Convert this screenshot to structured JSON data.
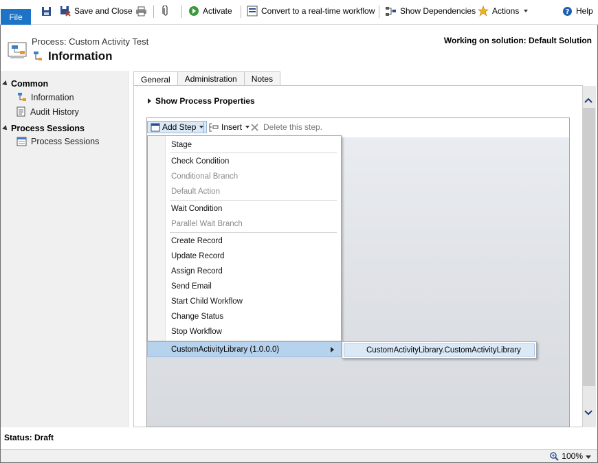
{
  "ribbon": {
    "file_label": "File",
    "save_close": "Save and Close",
    "activate": "Activate",
    "convert": "Convert to a real-time workflow",
    "show_dependencies": "Show Dependencies",
    "actions": "Actions",
    "help": "Help"
  },
  "header": {
    "subtitle": "Process: Custom Activity Test",
    "title": "Information",
    "solution": "Working on solution: Default Solution"
  },
  "nav": {
    "common": "Common",
    "information": "Information",
    "audit_history": "Audit History",
    "process_sessions_header": "Process Sessions",
    "process_sessions": "Process Sessions"
  },
  "tabs": [
    "General",
    "Administration",
    "Notes"
  ],
  "show_props": "Show Process Properties",
  "designer_toolbar": {
    "add_step": "Add Step",
    "insert": "Insert",
    "delete": "Delete this step."
  },
  "menu": {
    "stage": "Stage",
    "check_condition": "Check Condition",
    "conditional_branch": "Conditional Branch",
    "default_action": "Default Action",
    "wait_condition": "Wait Condition",
    "parallel_wait_branch": "Parallel Wait Branch",
    "create_record": "Create Record",
    "update_record": "Update Record",
    "assign_record": "Assign Record",
    "send_email": "Send Email",
    "start_child_workflow": "Start Child Workflow",
    "change_status": "Change Status",
    "stop_workflow": "Stop Workflow",
    "custom_library": "CustomActivityLibrary (1.0.0.0)"
  },
  "flyout_item": "CustomActivityLibrary.CustomActivityLibrary",
  "status": "Status: Draft",
  "zoom": "100%",
  "colors": {
    "file_button": "#1d73c5",
    "menu_highlight": "#b7d2ec",
    "canvas": "#dde0e5"
  }
}
